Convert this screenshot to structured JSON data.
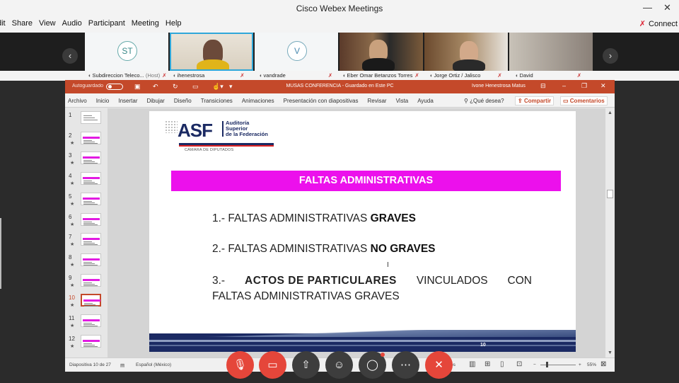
{
  "app": {
    "title": "Cisco Webex Meetings",
    "menu": [
      "dit",
      "Share",
      "View",
      "Audio",
      "Participant",
      "Meeting",
      "Help"
    ],
    "connect_label": "Connect"
  },
  "participants": [
    {
      "name": "Subdireccion Teleco...",
      "role": "(Host)",
      "initials": "ST"
    },
    {
      "name": "ihenestrosa",
      "role": "",
      "initials": ""
    },
    {
      "name": "vandrade",
      "role": "",
      "initials": "V"
    },
    {
      "name": "Eber Omar Betanzos Torres",
      "role": "",
      "initials": ""
    },
    {
      "name": "Jorge Ortiz / Jalisco",
      "role": "",
      "initials": ""
    },
    {
      "name": "David",
      "role": "",
      "initials": ""
    }
  ],
  "ppt": {
    "autosave_label": "Autoguardado",
    "doc_title": "MUSAS CONFERENCIA  -  Guardado en Este PC",
    "user": "Ivone Henestrosa Matus",
    "tabs": [
      "Archivo",
      "Inicio",
      "Insertar",
      "Dibujar",
      "Diseño",
      "Transiciones",
      "Animaciones",
      "Presentación con diapositivas",
      "Revisar",
      "Vista",
      "Ayuda"
    ],
    "ask": "¿Qué desea?",
    "share": "Compartir",
    "comments": "Comentarios",
    "thumb_numbers": [
      "1",
      "2",
      "3",
      "4",
      "5",
      "6",
      "7",
      "8",
      "9",
      "10",
      "11",
      "12"
    ],
    "active_slide": 10,
    "status_slide": "Diapositiva 10 de 27",
    "status_lang": "Español (México)",
    "status_os": "os",
    "zoom": "55%"
  },
  "slide": {
    "logo_word": "ASF",
    "logo_sub1": "Auditoría",
    "logo_sub2": "Superior",
    "logo_sub3": "de la Federación",
    "logo_house": "CÁMARA DE DIPUTADOS",
    "banner": "FALTAS ADMINISTRATIVAS",
    "item1_a": "1.- FALTAS ADMINISTRATIVAS ",
    "item1_b": "GRAVES",
    "item2_a": "2.- FALTAS ADMINISTRATIVAS ",
    "item2_b": "NO GRAVES",
    "item3_num": "3.-",
    "item3_bold": "ACTOS DE PARTICULARES",
    "item3_w1": "VINCULADOS",
    "item3_w2": "CON",
    "item3_line2": "FALTAS ADMINISTRATIVAS GRAVES",
    "page_number": "10"
  },
  "controls": [
    "mute",
    "stop-video",
    "share",
    "participants",
    "chat",
    "more",
    "leave"
  ]
}
